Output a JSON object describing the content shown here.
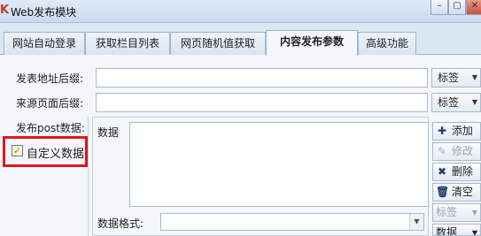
{
  "window": {
    "app_icon": "K",
    "title": "Web发布模块",
    "min_label": "–",
    "max_label": "▢",
    "close_label": "✕"
  },
  "tabs": [
    {
      "label": "网站自动登录"
    },
    {
      "label": "获取栏目列表"
    },
    {
      "label": "网页随机值获取"
    },
    {
      "label": "内容发布参数"
    },
    {
      "label": "高级功能"
    }
  ],
  "active_tab": "内容发布参数",
  "form": {
    "post_url_suffix_label": "发表地址后缀:",
    "post_url_suffix_value": "",
    "source_page_suffix_label": "来源页面后缀:",
    "source_page_suffix_value": "",
    "post_data_label": "发布post数据:",
    "tag_button_label": "标签",
    "custom_data_label": "自定义数据",
    "custom_data_checked": true,
    "data_label": "数据",
    "data_value": "",
    "data_format_label": "数据格式:",
    "data_format_value": ""
  },
  "side_buttons": {
    "add": "添加",
    "edit": "修改",
    "delete": "删除",
    "clear": "清空",
    "tag": "标签",
    "data": "数据"
  },
  "icons": {
    "add": "plus-icon",
    "edit": "pencil-icon",
    "delete": "x-icon",
    "clear": "trash-icon"
  },
  "colors": {
    "highlight_border": "#e0161b",
    "tab_active_bg": "#f3f6fa",
    "window_bg": "#dbe6f3"
  }
}
